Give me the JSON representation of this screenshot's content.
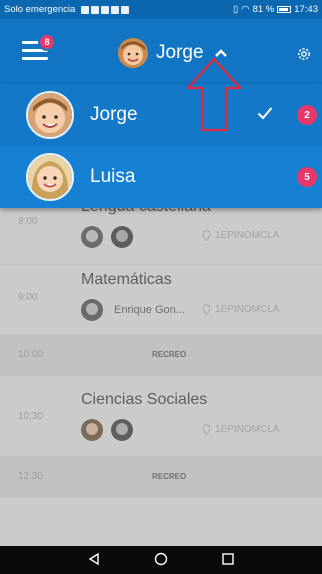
{
  "status_bar": {
    "carrier": "Solo emergencia",
    "battery": "81 %",
    "time": "17:43"
  },
  "header": {
    "menu_badge": "8",
    "current_profile": "Jorge"
  },
  "profiles": [
    {
      "name": "Jorge",
      "badge": "2",
      "selected": true
    },
    {
      "name": "Luisa",
      "badge": "5",
      "selected": false
    }
  ],
  "schedule": [
    {
      "time": "8:00",
      "subject": "Lengua castellana",
      "teacher": "",
      "room": "1EPINOMCLA"
    },
    {
      "time": "9:00",
      "subject": "Matemáticas",
      "teacher": "Enrique Gon...",
      "room": "1EPINOMCLA"
    },
    {
      "time": "10:00",
      "break": "RECREO"
    },
    {
      "time": "10:30",
      "subject": "Ciencias Sociales",
      "teacher": "",
      "room": "1EPINOMCLA"
    },
    {
      "time": "12:30",
      "break": "RECREO"
    }
  ],
  "colors": {
    "app_bar": "#1275c4",
    "status_bar": "#0b67b0",
    "badge": "#e8386a",
    "annotation": "#e0283a"
  },
  "icons": {
    "menu": "hamburger-icon",
    "settings": "gear-icon",
    "toggle": "chevron-up-icon",
    "check": "checkmark-icon",
    "room": "location-pin-icon",
    "nav_back": "triangle-back-icon",
    "nav_home": "circle-home-icon",
    "nav_recent": "square-recent-icon"
  }
}
